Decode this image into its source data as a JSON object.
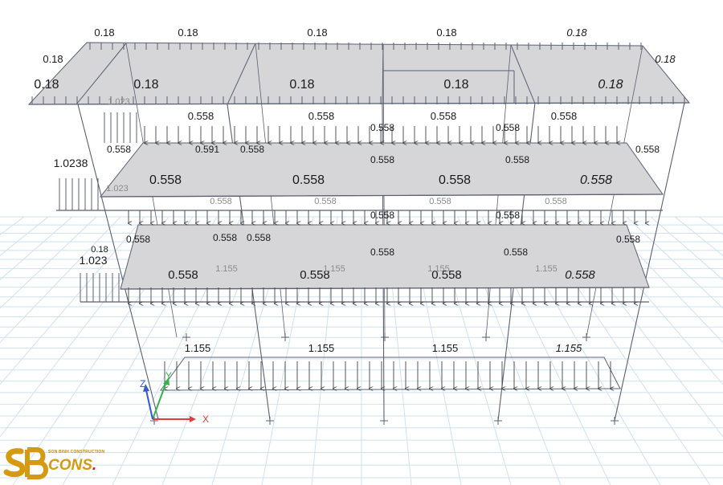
{
  "title": "",
  "roof": {
    "edge_loads": [
      "0.18",
      "0.18",
      "0.18",
      "0.18",
      "0.18"
    ],
    "side_load_left": "0.18",
    "side_load_right": "0.18",
    "area_loads": [
      "0.18",
      "0.18",
      "0.18",
      "0.18",
      "0.18"
    ]
  },
  "floor_upper": {
    "edge_loads": [
      "0.558",
      "0.558",
      "0.558",
      "0.558"
    ],
    "area_loads": [
      "0.558",
      "0.558",
      "0.558",
      "0.558"
    ],
    "faint_loads": [
      "1.023",
      "0.558",
      "0.558",
      "0.558",
      "0.558"
    ],
    "side_loads": [
      "0.558",
      "0.591",
      "0.558",
      "0.558",
      "0.558",
      "0.558",
      "0.558",
      "0.558"
    ],
    "left_overhang_load": "1.0238"
  },
  "floor_lower": {
    "area_loads": [
      "0.558",
      "0.558",
      "0.558",
      "0.558"
    ],
    "faint_loads": [
      "1.155",
      "1.155",
      "1.155",
      "1.155"
    ],
    "side_loads": [
      "0.558",
      "0.558",
      "0.558",
      "0.558",
      "0.558",
      "0.558",
      "0.558",
      "0.558"
    ],
    "left_overhang_load": "1.023",
    "left_small": "0.18"
  },
  "ground_beam": {
    "loads": [
      "1.155",
      "1.155",
      "1.155",
      "1.155"
    ]
  },
  "axes": {
    "x": "X",
    "y": "Y",
    "z": "Z"
  },
  "colors": {
    "line": "#5b6072",
    "slab": "#d6d6d9",
    "grid": "#cfe2ee",
    "axis_x": "#e0403a",
    "axis_y": "#35b24a",
    "axis_z": "#3557d6",
    "logo": "#d59a12"
  },
  "logo": {
    "subtitle": "SON BINH CONSTRUCTION",
    "word": "CONS",
    "dot": "."
  }
}
